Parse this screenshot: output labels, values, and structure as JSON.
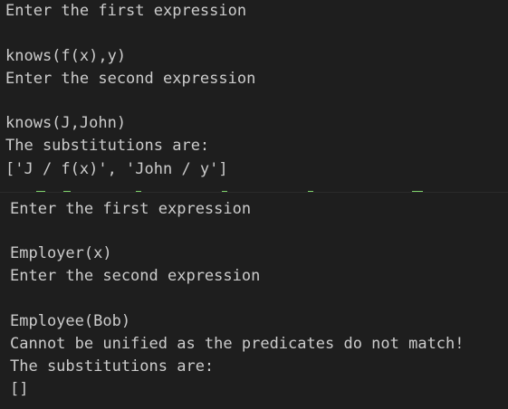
{
  "console_top": {
    "lines": [
      "Enter the first expression",
      "",
      "knows(f(x),y)",
      "Enter the second expression",
      "",
      "knows(J,John)",
      "The substitutions are:",
      "['J / f(x)', 'John / y']"
    ]
  },
  "console_bottom": {
    "lines": [
      "Enter the first expression",
      "",
      "Employer(x)",
      "Enter the second expression",
      "",
      "Employee(Bob)",
      "Cannot be unified as the predicates do not match!",
      "The substitutions are:",
      "[]"
    ]
  },
  "colors": {
    "background": "#1e1e1e",
    "text": "#cccccc",
    "artifact": "#7fd36b"
  }
}
